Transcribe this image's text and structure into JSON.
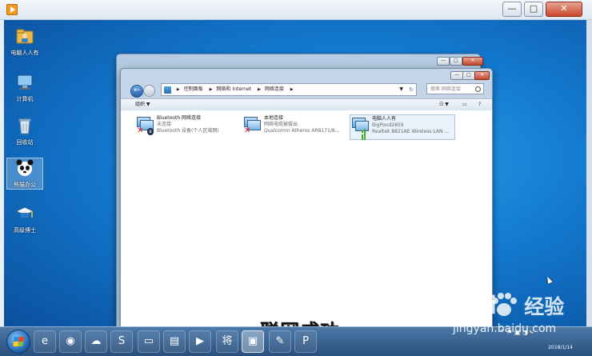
{
  "desktop": {
    "icons": [
      {
        "label": "电脑人人有",
        "icon": "folder-user-icon"
      },
      {
        "label": "计算机",
        "icon": "computer-icon"
      },
      {
        "label": "回收站",
        "icon": "recycle-bin-icon"
      },
      {
        "label": "熊猫办公",
        "icon": "panda-icon"
      },
      {
        "label": "高级博士",
        "icon": "graduation-cap-icon"
      }
    ]
  },
  "explorer": {
    "breadcrumbs": [
      "控制面板",
      "网络和 Internet",
      "网络连接"
    ],
    "search_placeholder": "搜索 网络连接",
    "toolbar": {
      "organize_label": "组织"
    },
    "connections": [
      {
        "name": "Bluetooth 网络连接",
        "status": "未连接",
        "adapter": "Bluetooth 设备(个人区域网)",
        "state": "disconnected"
      },
      {
        "name": "本地连接",
        "status": "网络电缆被拔出",
        "adapter": "Qualcomm Atheros AR8171/8...",
        "state": "disconnected"
      },
      {
        "name": "电脑人人有",
        "status": "BigPond2859",
        "adapter": "Realtek 8821AE Wireless LAN ...",
        "state": "connected"
      }
    ]
  },
  "overlay_text": "联网成功",
  "taskbar": {
    "date": "2018/1/14"
  },
  "watermark": {
    "logo": "Bai",
    "logo_suffix": "经验",
    "site": "jingyan.baidu.com"
  },
  "colors": {
    "desktop": "#137bd1",
    "titlebar_close": "#c7472c",
    "connected_bars": "#3fae2a",
    "disconnected_x": "#dd2222"
  }
}
